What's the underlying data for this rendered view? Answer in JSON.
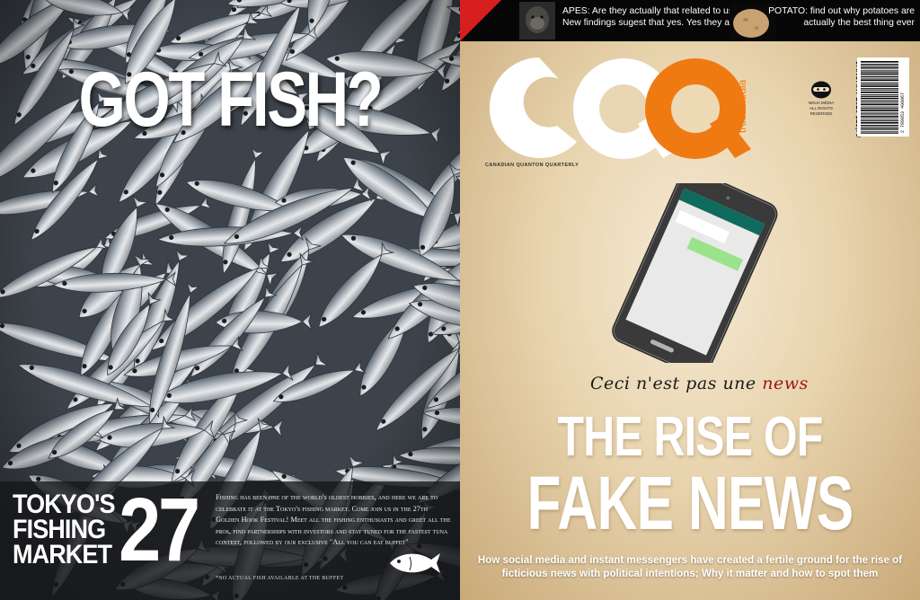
{
  "left_page": {
    "title": "GOT FISH?",
    "event_name_lines": [
      "TOKYO'S",
      "FISHING",
      "MARKET"
    ],
    "event_number": "27",
    "blurb": "Fishing has been one of the world's oldest hobbies, and here we are to celebrate it at the Tokyo's fishing market. Come join us in the 27th Golden Hook Festival! Meet all the fishing enthusiasts and greet all the pros, find partnerships with investors and stay tuned for the fastest tuna contest, followed by our exclusive \"All you can eat buffet\"",
    "footnote": "*NO ACTUAL FISH AVAILABLE AT THE BUFFET",
    "icon": "fish-icon"
  },
  "right_page": {
    "teasers": [
      {
        "text": "APES: Are they actually that related to us? New findings sugest that yes. Yes they are",
        "icon": "ape-photo"
      },
      {
        "text": "POTATO: find out why potatoes are actually the best thing ever",
        "icon": "potato-photo"
      }
    ],
    "logo": {
      "letters": [
        "C",
        "Q",
        "Q"
      ],
      "side_text": "trost media",
      "subtitle": "CANADIAN QUANTON QUARTERLY"
    },
    "publisher_mark": {
      "lines": [
        "NINJA MEDIA",
        "ALL RIGHTS",
        "RESERVED"
      ],
      "icon": "ninja-icon"
    },
    "issue": "JANUARY 2020 $15,79",
    "barcode_number": "2 799953 400067",
    "tagline_parts": [
      "Ceci n'est pas une ",
      "news"
    ],
    "headline_lines": [
      "THE RISE OF",
      "FAKE NEWS"
    ],
    "deck": "How social media and instant messengers have created a fertile ground for the rise of ficticious news with political intentions; Why it matter and how to spot them"
  },
  "colors": {
    "accent_red": "#d81e1e",
    "logo_orange": "#f07a12",
    "tagline_red": "#9a1515",
    "chat_header": "#0e6b5e",
    "chat_bubble": "#9be38a"
  }
}
